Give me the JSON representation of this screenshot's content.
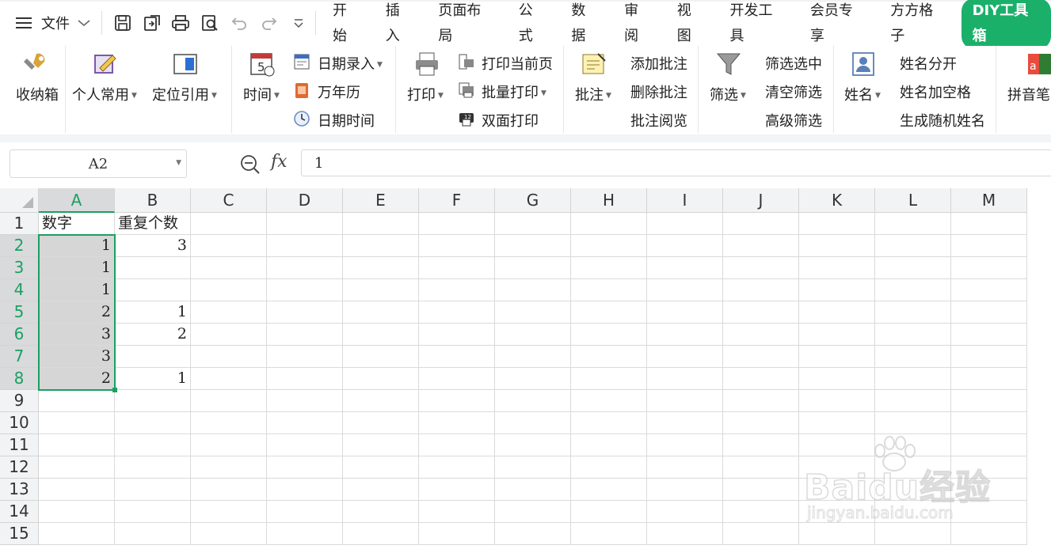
{
  "menu": {
    "file_label": "文件",
    "tabs": [
      "开始",
      "插入",
      "页面布局",
      "公式",
      "数据",
      "审阅",
      "视图",
      "开发工具",
      "会员专享",
      "方方格子",
      "DIY工具箱"
    ]
  },
  "ribbon": {
    "toolbox": "收纳箱",
    "personal": "个人常用",
    "locate_ref": "定位引用",
    "time": "时间",
    "date_entry": "日期录入",
    "perpetual_calendar": "万年历",
    "date_time": "日期时间",
    "print": "打印",
    "print_current_page": "打印当前页",
    "batch_print": "批量打印",
    "duplex_print": "双面打印",
    "comment": "批注",
    "add_comment": "添加批注",
    "delete_comment": "删除批注",
    "view_comment": "批注阅览",
    "filter": "筛选",
    "filter_selected": "筛选选中",
    "clear_filter": "清空筛选",
    "advanced_filter": "高级筛选",
    "name": "姓名",
    "name_split": "姓名分开",
    "name_add_space": "姓名加空格",
    "random_name": "生成随机姓名",
    "pinyin": "拼音笔"
  },
  "formula_bar": {
    "name_box": "A2",
    "fx_label": "fx",
    "value": "1"
  },
  "sheet": {
    "columns": [
      "A",
      "B",
      "C",
      "D",
      "E",
      "F",
      "G",
      "H",
      "I",
      "J",
      "K",
      "L",
      "M"
    ],
    "rows": [
      "1",
      "2",
      "3",
      "4",
      "5",
      "6",
      "7",
      "8",
      "9",
      "10",
      "11",
      "12",
      "13",
      "14",
      "15"
    ],
    "cells": {
      "A1": "数字",
      "B1": "重复个数",
      "A2": "1",
      "B2": "3",
      "A3": "1",
      "A4": "1",
      "A5": "2",
      "B5": "1",
      "A6": "3",
      "B6": "2",
      "A7": "3",
      "A8": "2",
      "B8": "1"
    },
    "selection": "A2:A8"
  },
  "watermark": {
    "main": "Baidu经验",
    "sub": "jingyan.baidu.com"
  }
}
